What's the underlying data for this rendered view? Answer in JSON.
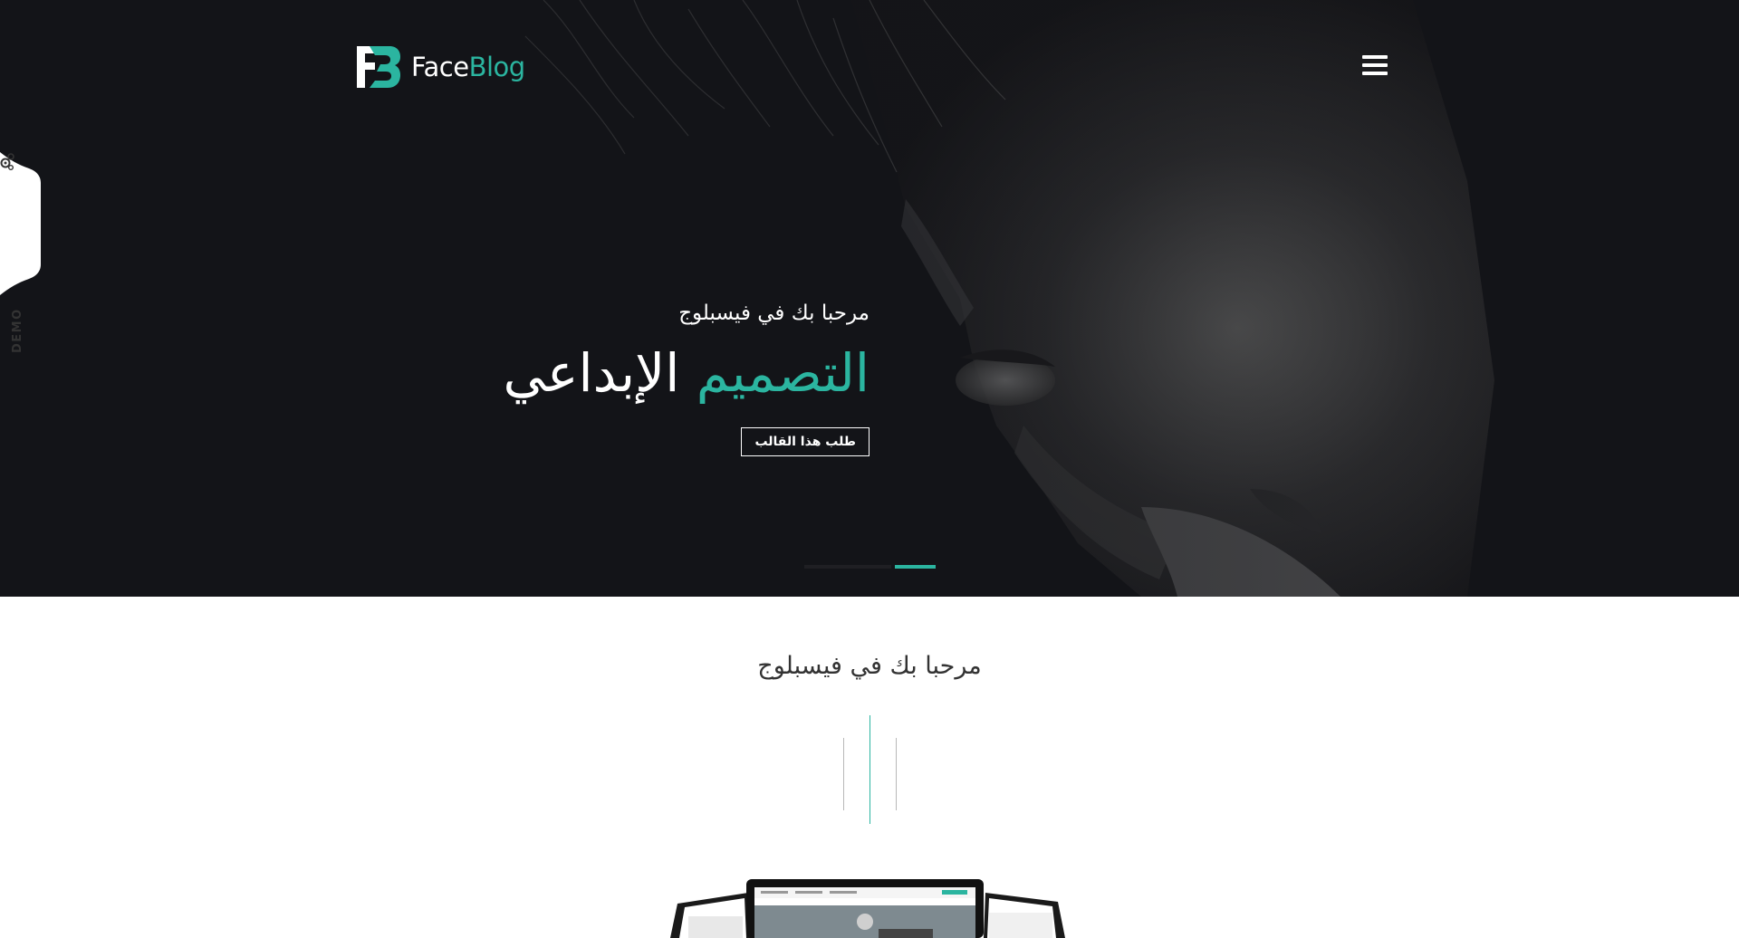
{
  "header": {
    "logo_part1": "Face",
    "logo_part2": "Blog",
    "menu_icon": "hamburger-icon"
  },
  "demo_tab": {
    "label": "DEMO",
    "icon": "gears-icon"
  },
  "hero": {
    "subtitle": "مرحبا بك في فيسبلوج",
    "title_highlight": "التصميم",
    "title_rest": "الإبداعي",
    "button_label": "طلب هذا القالب",
    "slides_count": 2,
    "active_slide": 2
  },
  "welcome": {
    "title": "مرحبا بك في فيسبلوج"
  },
  "colors": {
    "accent": "#2bb5a0",
    "hero_bg": "#131418",
    "text_dark": "#333333"
  }
}
